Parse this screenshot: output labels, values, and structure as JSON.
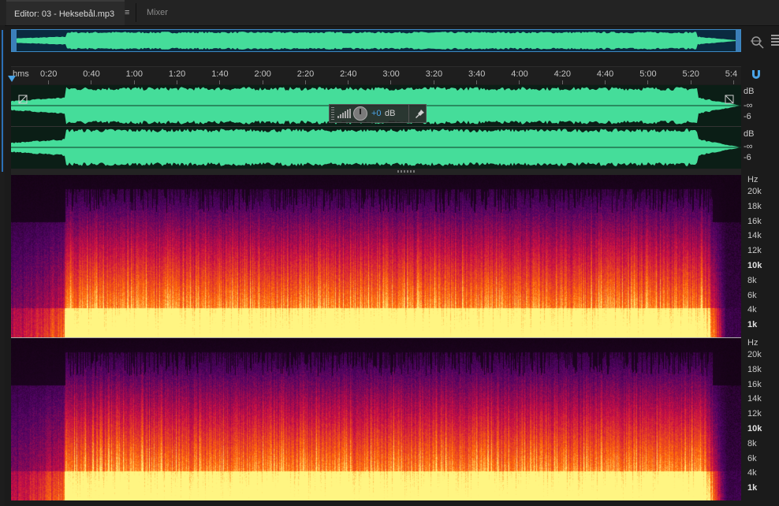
{
  "tabs": {
    "editor_label": "Editor: 03 - Heksebål.mp3",
    "menu_glyph": "≡",
    "mixer_label": "Mixer"
  },
  "icons": {
    "zoom": "zoom-icon",
    "panel": "panel-menu-icon",
    "snap": "snap-magnet-icon",
    "pin": "pin-icon"
  },
  "ruler": {
    "unit": "hms",
    "ticks": [
      "0:20",
      "0:40",
      "1:00",
      "1:20",
      "1:40",
      "2:00",
      "2:20",
      "2:40",
      "3:00",
      "3:20",
      "3:40",
      "4:00",
      "4:20",
      "4:40",
      "5:00",
      "5:20",
      "5:4"
    ]
  },
  "waveform": {
    "db_label": "dB",
    "neg_inf": "-∞",
    "minus6": "-6"
  },
  "hud": {
    "gain_value": "+0",
    "gain_unit": "dB"
  },
  "spectral": {
    "hz_label": "Hz",
    "freq_labels": [
      "20k",
      "18k",
      "16k",
      "14k",
      "12k",
      "10k",
      "8k",
      "6k",
      "4k",
      "1k"
    ]
  },
  "colors": {
    "waveform": "#45dd9a",
    "accent": "#4aa3e6",
    "overview_bg": "#0a2a40"
  }
}
